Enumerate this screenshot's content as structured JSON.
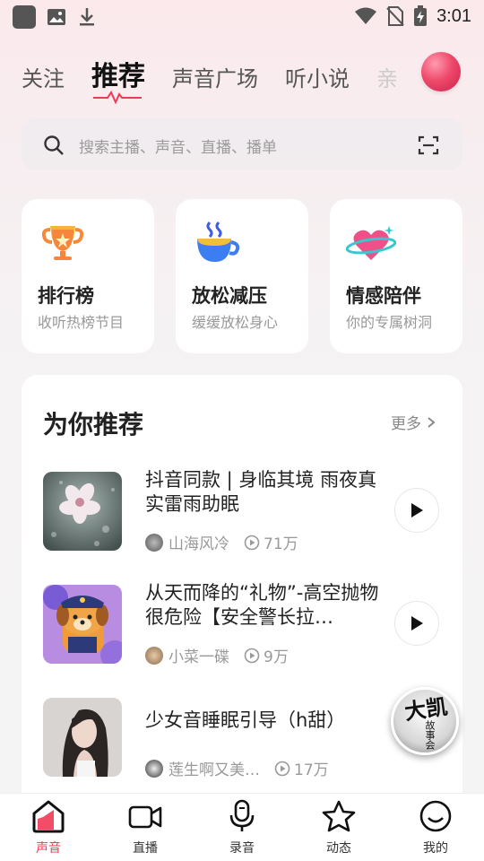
{
  "status_bar": {
    "time": "3:01"
  },
  "top_tabs": [
    {
      "label": "关注"
    },
    {
      "label": "推荐"
    },
    {
      "label": "声音广场"
    },
    {
      "label": "听小说"
    },
    {
      "label": "亲"
    }
  ],
  "search": {
    "placeholder": "搜索主播、声音、直播、播单"
  },
  "category_cards": [
    {
      "title": "排行榜",
      "subtitle": "收听热榜节目",
      "icon": "trophy-icon"
    },
    {
      "title": "放松减压",
      "subtitle": "缓缓放松身心",
      "icon": "coffee-cup-icon"
    },
    {
      "title": "情感陪伴",
      "subtitle": "你的专属树洞",
      "icon": "heart-planet-icon"
    }
  ],
  "recommend": {
    "title": "为你推荐",
    "more_label": "更多",
    "items": [
      {
        "title": "抖音同款 | 身临其境 雨夜真实雷雨助眠",
        "author": "山海风冷",
        "plays": "71万"
      },
      {
        "title": "从天而降的“礼物”-高空抛物很危险【安全警长拉…",
        "author": "小菜一碟",
        "plays": "9万"
      },
      {
        "title": "少女音睡眠引导（h甜）",
        "author": "莲生啊又美…",
        "plays": "17万"
      }
    ]
  },
  "floating_badge": {
    "text": "大凯",
    "sub": "故事会"
  },
  "bottom_nav": [
    {
      "label": "声音",
      "icon": "home-sound-icon",
      "active": true
    },
    {
      "label": "直播",
      "icon": "video-camera-icon",
      "active": false
    },
    {
      "label": "录音",
      "icon": "microphone-icon",
      "active": false
    },
    {
      "label": "动态",
      "icon": "star-icon",
      "active": false
    },
    {
      "label": "我的",
      "icon": "profile-icon",
      "active": false
    }
  ],
  "colors": {
    "accent": "#f03a55",
    "background": "#f5f4f5"
  }
}
